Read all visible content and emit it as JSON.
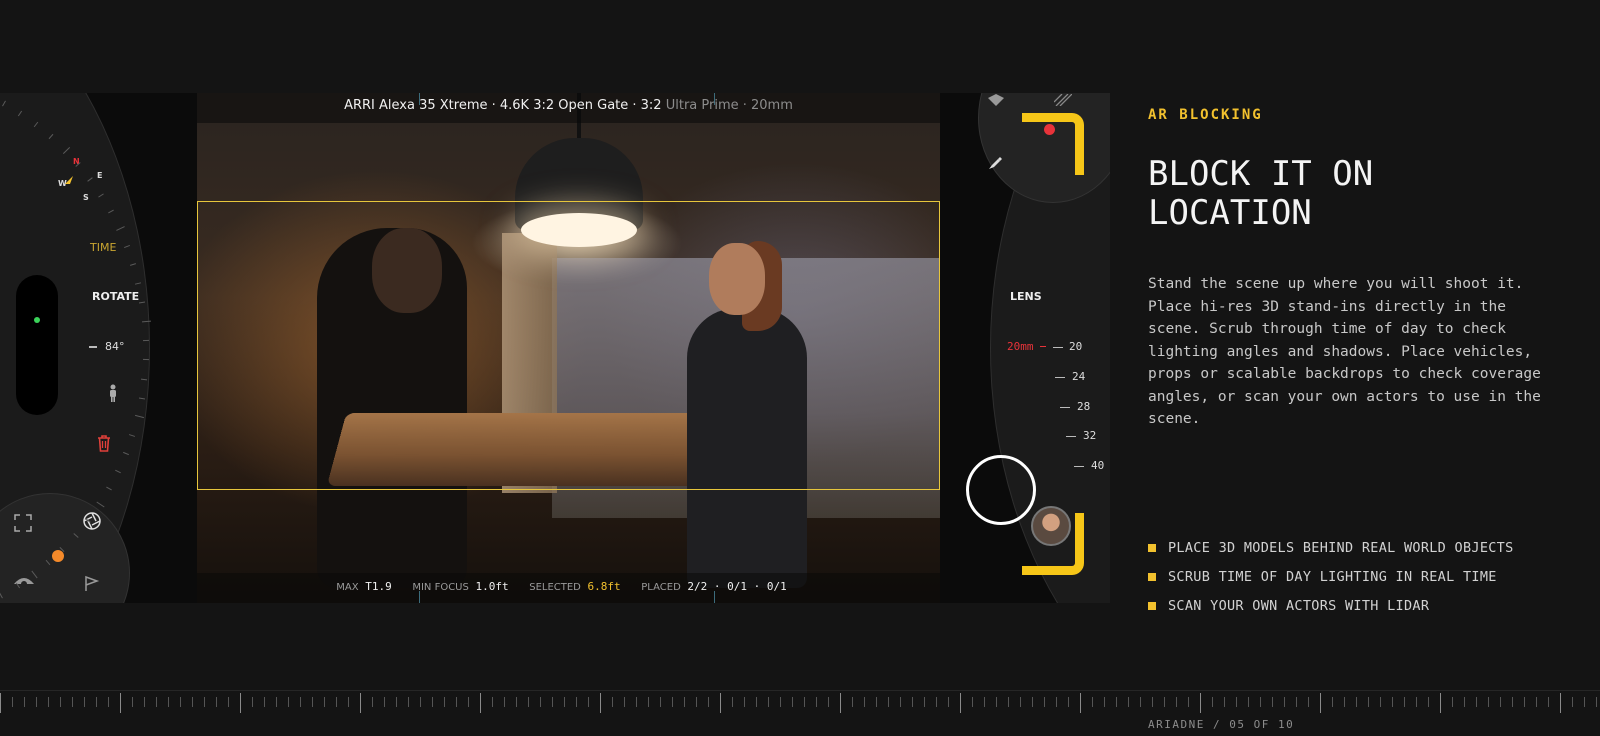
{
  "viewport": {
    "camera": "ARRI Alexa 35 Xtreme · 4.6K 3:2 Open Gate · 3:2",
    "lens_info": "Ultra Prime · 20mm",
    "stats": {
      "max_label": "MAX",
      "max_value": "T1.9",
      "min_focus_label": "MIN FOCUS",
      "min_focus_value": "1.0ft",
      "selected_label": "SELECTED",
      "selected_value": "6.8ft",
      "placed_label": "PLACED",
      "placed_value": "2/2 · 0/1 · 0/1"
    },
    "frame_color": "#e7c63c"
  },
  "left_panel": {
    "compass": {
      "n": "N",
      "e": "E",
      "s": "S",
      "w": "W"
    },
    "time_label": "TIME",
    "rotate_label": "ROTATE",
    "angle": "84°",
    "icons": [
      "person-icon",
      "trash-icon",
      "focus-frame-icon",
      "aperture-icon",
      "eye-icon",
      "flag-icon"
    ],
    "status_color": "#3bd35a"
  },
  "right_panel": {
    "lens_label": "LENS",
    "current_focal": "20mm",
    "focal_marks": [
      "20",
      "24",
      "28",
      "32",
      "40"
    ],
    "icons": [
      "compass-icon",
      "pen-icon",
      "shutter-button",
      "actor-avatar"
    ],
    "accent": "#f6c618",
    "record_color": "#e8333a"
  },
  "content": {
    "eyebrow": "AR BLOCKING",
    "headline_line1": "BLOCK IT ON",
    "headline_line2": "LOCATION",
    "body": "Stand the scene up where you will shoot it. Place hi-res 3D stand-ins directly in the scene. Scrub through time of day to check lighting angles and shadows. Place vehicles, props or scalable backdrops to check coverage angles, or scan your own actors to use in the scene.",
    "bullets": [
      "PLACE 3D MODELS BEHIND REAL WORLD OBJECTS",
      "SCRUB TIME OF DAY LIGHTING IN REAL TIME",
      "SCAN YOUR OWN ACTORS WITH LIDAR"
    ]
  },
  "footer": {
    "label": "ARIADNE / 05 OF 10"
  }
}
